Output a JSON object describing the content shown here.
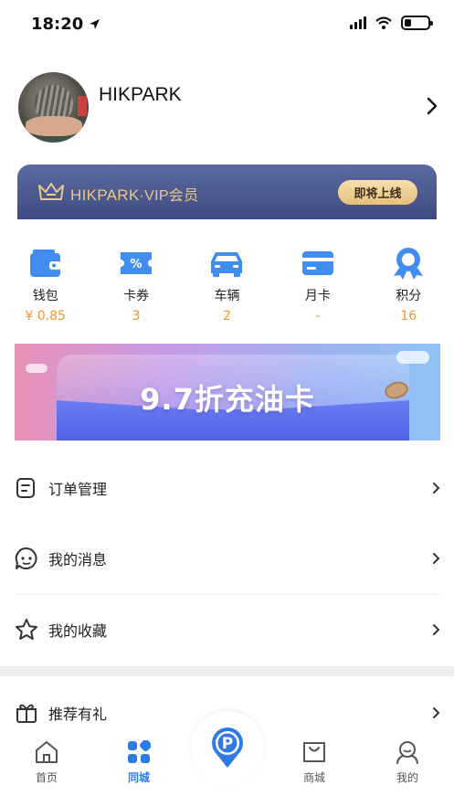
{
  "status_bar": {
    "time": "18:20",
    "battery_level": 0.3
  },
  "profile": {
    "username": "HIKPARK"
  },
  "vip_banner": {
    "brand": "HIKPARK",
    "tier": "·VIP会员",
    "button_label": "即将上线",
    "gold_color": "#e8c98a"
  },
  "stats": [
    {
      "icon": "wallet-icon",
      "label": "钱包",
      "value": "¥ 0.85"
    },
    {
      "icon": "coupon-icon",
      "label": "卡券",
      "value": "3"
    },
    {
      "icon": "car-icon",
      "label": "车辆",
      "value": "2"
    },
    {
      "icon": "card-icon",
      "label": "月卡",
      "value": "-"
    },
    {
      "icon": "badge-icon",
      "label": "积分",
      "value": "16"
    }
  ],
  "promo": {
    "text": "9.7折充油卡"
  },
  "menu": [
    {
      "icon": "order-icon",
      "label": "订单管理"
    },
    {
      "icon": "message-icon",
      "label": "我的消息"
    },
    {
      "icon": "star-icon",
      "label": "我的收藏"
    },
    {
      "icon": "gift-icon",
      "label": "推荐有礼"
    }
  ],
  "tabbar": {
    "items": [
      {
        "icon": "home-icon",
        "label": "首页"
      },
      {
        "icon": "grid-icon",
        "label": "同城",
        "active": true
      },
      {
        "icon": "parking-icon",
        "label": ""
      },
      {
        "icon": "shop-icon",
        "label": "商城"
      },
      {
        "icon": "profile-icon",
        "label": "我的"
      }
    ]
  },
  "colors": {
    "accent": "#2f7be6",
    "value_orange": "#f0962a",
    "vip_bg": "#4a5990"
  }
}
